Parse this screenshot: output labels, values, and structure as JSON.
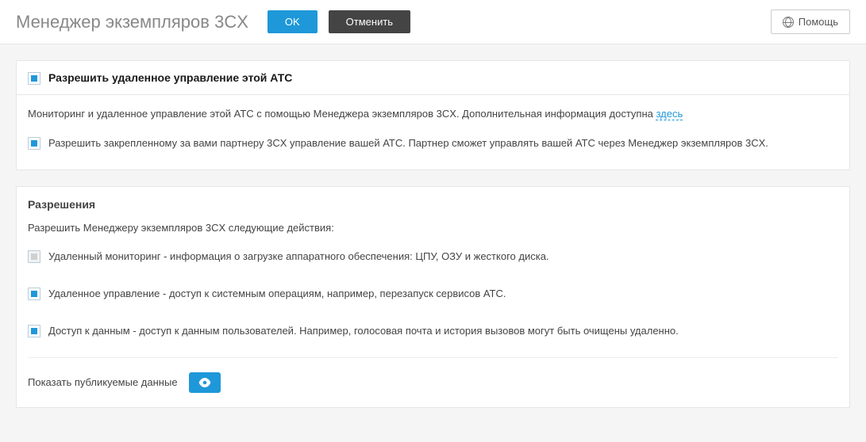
{
  "header": {
    "title": "Менеджер экземпляров 3CX",
    "ok": "OK",
    "cancel": "Отменить",
    "help": "Помощь"
  },
  "remote_panel": {
    "title": "Разрешить удаленное управление этой АТС",
    "info_prefix": "Мониторинг и удаленное управление этой АТС с помощью Менеджера экземпляров 3CX. Дополнительная информация доступна ",
    "info_link": "здесь",
    "partner_label": "Разрешить закрепленному за вами партнеру 3CX управление вашей АТС. Партнер сможет управлять вашей АТС через Менеджер экземпляров 3CX."
  },
  "permissions_panel": {
    "title": "Разрешения",
    "intro": "Разрешить Менеджеру экземпляров 3CX следующие действия:",
    "items": [
      {
        "label": "Удаленный мониторинг - информация о загрузке аппаратного обеспечения: ЦПУ, ОЗУ и жесткого диска.",
        "state": "disabled"
      },
      {
        "label": "Удаленное управление - доступ к системным операциям, например, перезапуск сервисов АТС.",
        "state": "checked"
      },
      {
        "label": "Доступ к данным - доступ к данным пользователей. Например, голосовая почта и история вызовов могут быть очищены удаленно.",
        "state": "checked"
      }
    ],
    "show_published": "Показать публикуемые данные"
  }
}
